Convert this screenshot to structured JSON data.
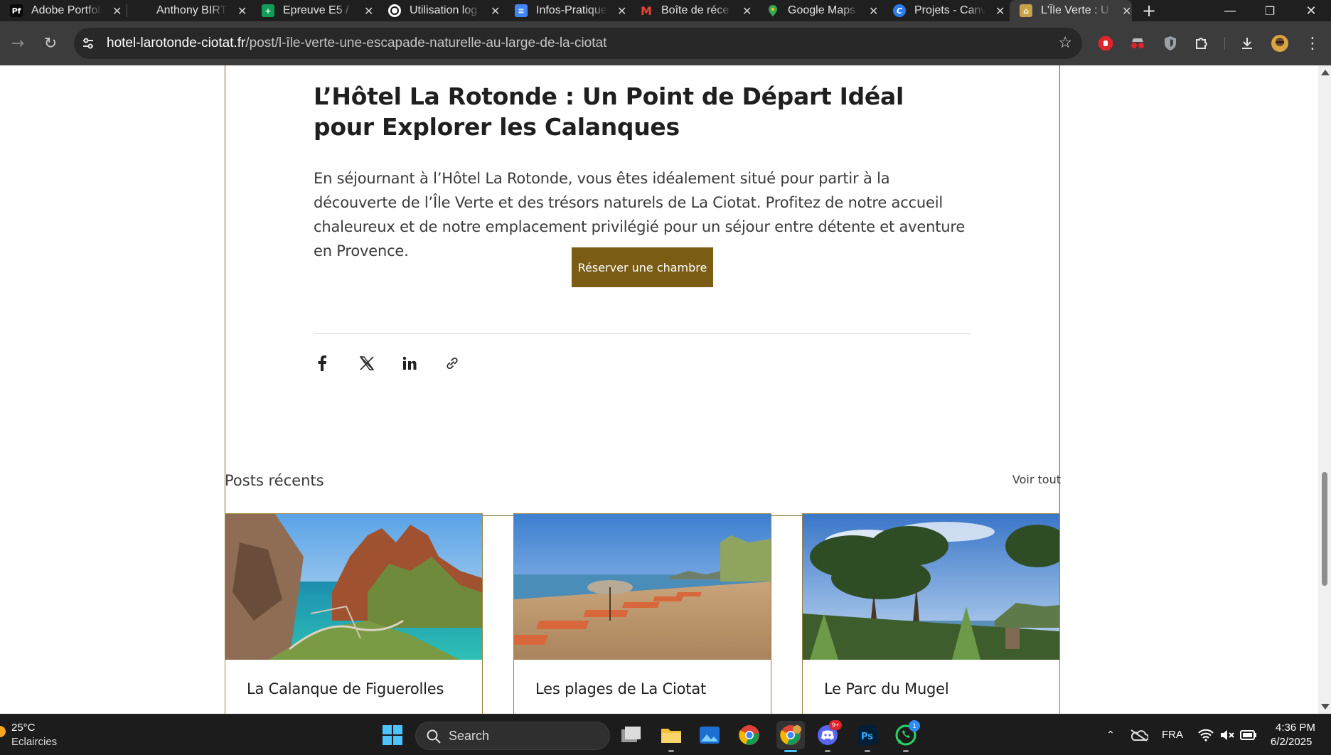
{
  "browser": {
    "tabs": [
      {
        "title": "Adobe Portfolio",
        "icon": "adobe-portfolio-icon",
        "icon_text": "Pf",
        "color": "#0a0a0a"
      },
      {
        "title": "Anthony BIRT",
        "icon": "generic-site-icon",
        "color": "#1f1f1f"
      },
      {
        "title": "Epreuve E5 /",
        "icon": "google-sheets-icon",
        "color": "#0f9d58"
      },
      {
        "title": "Utilisation log",
        "icon": "openai-icon",
        "color": "#ffffff"
      },
      {
        "title": "Infos-Pratique",
        "icon": "google-docs-icon",
        "color": "#4285f4"
      },
      {
        "title": "Boîte de réce",
        "icon": "gmail-icon",
        "color": "#ea4335"
      },
      {
        "title": "Google Maps",
        "icon": "google-maps-icon",
        "color": "#34a853"
      },
      {
        "title": "Projets - Canv",
        "icon": "canva-icon",
        "color": "#00c4cc"
      },
      {
        "title": "L'Île Verte : U",
        "icon": "hotel-icon",
        "color": "#c8a24a",
        "active": true
      }
    ],
    "url_domain": "hotel-larotonde-ciotat.fr",
    "url_path": "/post/l-île-verte-une-escapade-naturelle-au-large-de-la-ciotat"
  },
  "post": {
    "heading": "L’Hôtel La Rotonde : Un Point de Départ Idéal pour Explorer les Calanques",
    "paragraph": "En séjournant à l’Hôtel La Rotonde, vous êtes idéalement situé pour partir à la découverte de l’Île Verte et des trésors naturels de La Ciotat. Profitez de notre accueil chaleureux et de notre emplacement privilégié pour un séjour entre détente et aventure en Provence.",
    "cta_label": "Réserver une chambre",
    "cta_color": "#7a5c14",
    "share_icons": [
      "facebook-icon",
      "x-icon",
      "linkedin-icon",
      "link-icon"
    ]
  },
  "recent": {
    "title": "Posts récents",
    "see_all": "Voir tout",
    "cards": [
      {
        "caption": "La Calanque de Figuerolles"
      },
      {
        "caption": "Les plages de La Ciotat"
      },
      {
        "caption": "Le Parc du Mugel"
      }
    ]
  },
  "taskbar": {
    "weather_temp": "25°C",
    "weather_text": "Eclaircies",
    "search_label": "Search",
    "discord_badge": "9+",
    "whatsapp_badge": "1",
    "language": "FRA",
    "time": "4:36 PM",
    "date": "6/2/2025"
  }
}
